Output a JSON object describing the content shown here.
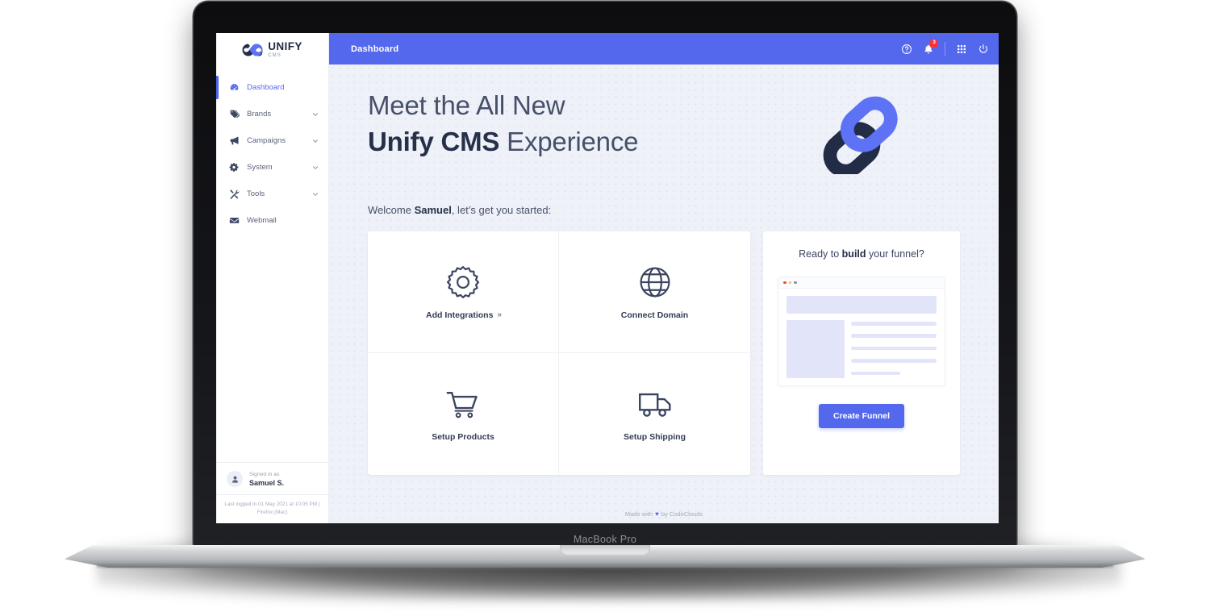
{
  "device": {
    "model_label": "MacBook Pro"
  },
  "brand": {
    "name": "UNIFY",
    "sub": "CMS",
    "logo_icon": "unify-chain-logo-icon"
  },
  "sidebar": {
    "items": [
      {
        "label": "Dashboard",
        "icon": "dashboard-gauge-icon",
        "active": true,
        "expandable": false
      },
      {
        "label": "Brands",
        "icon": "tag-icon",
        "active": false,
        "expandable": true
      },
      {
        "label": "Campaigns",
        "icon": "megaphone-icon",
        "active": false,
        "expandable": true
      },
      {
        "label": "System",
        "icon": "gear-icon",
        "active": false,
        "expandable": true
      },
      {
        "label": "Tools",
        "icon": "tools-icon",
        "active": false,
        "expandable": true
      },
      {
        "label": "Webmail",
        "icon": "envelope-icon",
        "active": false,
        "expandable": false
      }
    ],
    "account": {
      "signed_in_label": "Signed in as",
      "user_name": "Samuel S.",
      "avatar_icon": "user-avatar-icon"
    },
    "last_login": "Last logged in 01 May 2021 at 10:05 PM  |  Firefox (Mac)"
  },
  "topbar": {
    "title": "Dashboard",
    "accent_color": "#5468ee",
    "help_icon": "help-circle-icon",
    "notifications_icon": "bell-icon",
    "notifications_badge": "3",
    "badge_color": "#f5333f",
    "apps_icon": "grid-apps-icon",
    "power_icon": "power-icon"
  },
  "hero": {
    "line1": "Meet the All New",
    "line2_bold": "Unify CMS",
    "line2_rest": "Experience",
    "logo_icon": "unify-chain-logo-large-icon",
    "logo_dark": "#232c46",
    "logo_blue": "#5d72f5"
  },
  "welcome": {
    "prefix": "Welcome",
    "name": "Samuel",
    "suffix": ", let’s get you started:"
  },
  "quick_actions": [
    {
      "label": "Add Integrations",
      "icon": "gear-icon",
      "arrow": "»"
    },
    {
      "label": "Connect Domain",
      "icon": "globe-icon",
      "arrow": ""
    },
    {
      "label": "Setup Products",
      "icon": "shopping-cart-icon",
      "arrow": ""
    },
    {
      "label": "Setup Shipping",
      "icon": "delivery-truck-icon",
      "arrow": ""
    }
  ],
  "funnel_card": {
    "title_prefix": "Ready to",
    "title_bold": "build",
    "title_suffix": "your funnel?",
    "mock_icon": "browser-window-mockup-icon",
    "mock_dots": [
      "#f04a3f",
      "#f5bf3f",
      "#8b909c"
    ],
    "cta_label": "Create Funnel",
    "cta_color": "#5468ee"
  },
  "footer": {
    "prefix": "Made with",
    "heart": "♥",
    "suffix": "by CodeClouds"
  }
}
